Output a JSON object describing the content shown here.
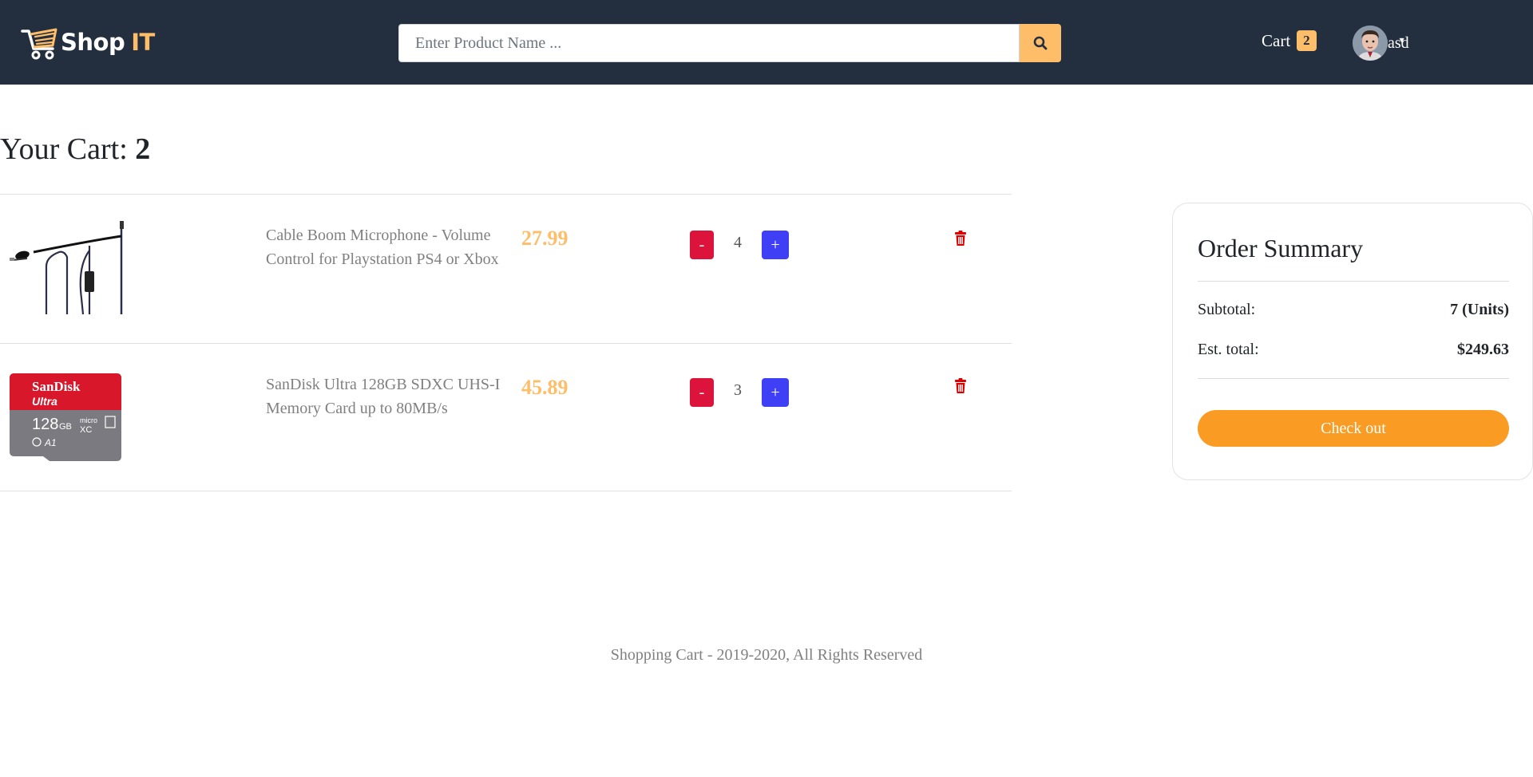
{
  "header": {
    "logo_text_1": "Shop",
    "logo_text_2": "IT",
    "search_placeholder": "Enter Product Name ...",
    "search_value": "",
    "cart_label": "Cart",
    "cart_count": "2",
    "user_name": "asd",
    "caret": "▾"
  },
  "cart": {
    "title_prefix": "Your Cart: ",
    "title_count": "2",
    "items": [
      {
        "name": "Cable Boom Microphone - Volume Control for Playstation PS4 or Xbox",
        "price": "27.99",
        "quantity": "4",
        "minus_label": "-",
        "plus_label": "+"
      },
      {
        "name": "SanDisk Ultra 128GB SDXC UHS-I Memory Card up to 80MB/s",
        "price": "45.89",
        "quantity": "3",
        "minus_label": "-",
        "plus_label": "+"
      }
    ]
  },
  "summary": {
    "title": "Order Summary",
    "subtotal_label": "Subtotal:",
    "subtotal_value": "7 (Units)",
    "total_label": "Est. total:",
    "total_value": "$249.63",
    "checkout_label": "Check out"
  },
  "sd_card": {
    "brand": "SanDisk",
    "line": "Ultra",
    "capacity": "128",
    "unit": "GB",
    "type": "micro",
    "xc": "XC",
    "a1": "A1"
  },
  "footer": {
    "text": "Shopping Cart - 2019-2020, All Rights Reserved"
  },
  "colors": {
    "navbar": "#232f3e",
    "accent": "#febd69",
    "minus": "#dc143c",
    "plus": "#3f3ff5",
    "checkout": "#fa9c23",
    "delete": "#dc0000"
  }
}
